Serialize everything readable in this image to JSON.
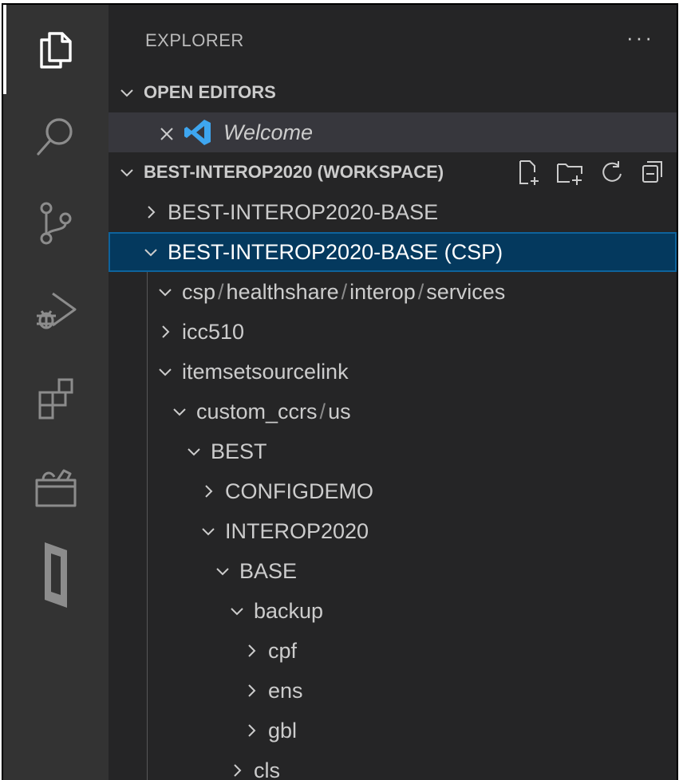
{
  "sidebar": {
    "title": "EXPLORER",
    "more_label": "···",
    "open_editors": {
      "header": "OPEN EDITORS",
      "items": [
        {
          "label": "Welcome"
        }
      ]
    },
    "workspace": {
      "header": "BEST-INTEROP2020 (WORKSPACE)",
      "actions": [
        "new-file-icon",
        "new-folder-icon",
        "refresh-icon",
        "collapse-all-icon"
      ]
    },
    "tree": {
      "base_folder": "BEST-INTEROP2020-BASE",
      "csp_folder": "BEST-INTEROP2020-BASE (CSP)",
      "path": {
        "p1": "csp",
        "p2": "healthshare",
        "p3": "interop",
        "p4": "services",
        "separator": "/"
      },
      "icc510": "icc510",
      "itemsetsourcelink": "itemsetsourcelink",
      "custom": {
        "p1": "custom_ccrs",
        "p2": "us"
      },
      "best": "BEST",
      "configdemo": "CONFIGDEMO",
      "interop2020": "INTEROP2020",
      "base": "BASE",
      "backup": "backup",
      "cpf": "cpf",
      "ens": "ens",
      "gbl": "gbl",
      "cls": "cls"
    }
  },
  "colors": {
    "activity_bar": "#333333",
    "sidebar": "#252526",
    "selected_row": "#04395e",
    "selected_border": "#0e639c",
    "vscode_blue": "#3ea6f0"
  }
}
